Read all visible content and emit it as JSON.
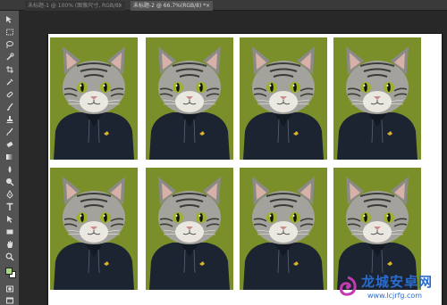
{
  "tabs": [
    {
      "label": "未标题-1 @ 100% (图像尺寸, RGB/8)",
      "close": "×"
    },
    {
      "label": "未标题-2 @ 66.7%(RGB/8) *",
      "close": "×"
    }
  ],
  "toolbar": {
    "tools": [
      "move-icon",
      "marquee-icon",
      "lasso-icon",
      "quick-select-icon",
      "crop-icon",
      "eyedropper-icon",
      "healing-brush-icon",
      "brush-icon",
      "clone-stamp-icon",
      "history-brush-icon",
      "eraser-icon",
      "gradient-icon",
      "blur-icon",
      "dodge-icon",
      "pen-icon",
      "type-icon",
      "path-select-icon",
      "rectangle-icon",
      "hand-icon",
      "zoom-icon"
    ],
    "foreground_color": "#a7d67e",
    "background_color": "#ffffff"
  },
  "canvas": {
    "photo_count": 8,
    "photo_background": "#7a8f2a"
  },
  "watermark": {
    "title": "龙城安卓网",
    "url": "www.lcjrfg.com",
    "color": "#2b6ccf"
  }
}
